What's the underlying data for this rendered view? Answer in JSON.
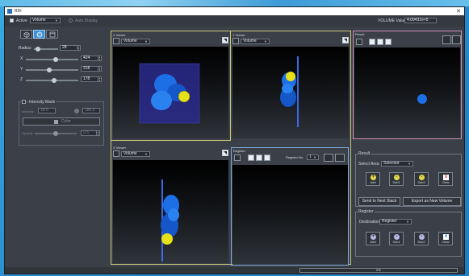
{
  "window": {
    "title": "RDI"
  },
  "toolbar": {
    "active_label": "Active",
    "active_checked": true,
    "dataset": "Volume",
    "auto_display_label": "Auto Display",
    "volume_value_label": "VOLUME Value",
    "volume_value": "4.09431e+5"
  },
  "left_panel": {
    "radius_label": "Radius",
    "radius_value": "28",
    "x_label": "X",
    "x_value": "424",
    "y_label": "Y",
    "y_value": "318",
    "z_label": "Z",
    "z_value": "178",
    "intensity_mask_label": "Intensity Mask",
    "min_label": "Intensity",
    "min_value": "18.5",
    "max_value": "180.5",
    "color_label": "Color",
    "opacity_label": "Opacity",
    "opacity_value": "0.5"
  },
  "viewers": {
    "z": {
      "title": "Z Viewer",
      "mode": "Volume"
    },
    "y": {
      "title": "Y Viewer",
      "mode": "Volume"
    },
    "x": {
      "title": "X Viewer",
      "mode": "Volume"
    },
    "result": {
      "title": "Result"
    },
    "register": {
      "title": "Register",
      "number_label": "Register No.",
      "number_value": "1"
    }
  },
  "result_panel": {
    "title": "Result",
    "select_area_label": "Select Area",
    "select_area_value": "Selected",
    "buttons": [
      {
        "label": "Add",
        "icon": "+"
      },
      {
        "label": "Sub1",
        "icon": "-"
      },
      {
        "label": "Sub2",
        "icon": "-"
      },
      {
        "label": "Clear",
        "icon": "x"
      }
    ],
    "send_label": "Send to Next Stack",
    "export_label": "Export as New Volume"
  },
  "register_panel": {
    "title": "Register",
    "destination_label": "Destination",
    "destination_value": "Register",
    "buttons": [
      {
        "label": "Add",
        "icon": "+"
      },
      {
        "label": "Sub1",
        "icon": "-"
      },
      {
        "label": "Sub2",
        "icon": "-"
      },
      {
        "label": "Clear",
        "icon": "x"
      }
    ]
  },
  "status": {
    "progress_text": "0%",
    "progress_value": 0
  },
  "colors": {
    "z_frame": "#c9c97a",
    "result_frame": "#d58fb6",
    "register_frame": "#7fb0e0",
    "accent": "#3c8fd6"
  }
}
